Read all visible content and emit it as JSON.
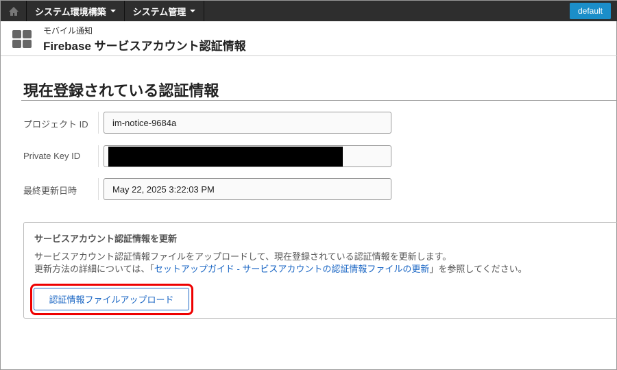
{
  "topbar": {
    "menus": [
      "システム環境構築",
      "システム管理"
    ],
    "user_button": "default"
  },
  "header": {
    "breadcrumb": "モバイル通知",
    "title": "Firebase サービスアカウント認証情報"
  },
  "section": {
    "title": "現在登録されている認証情報",
    "fields": [
      {
        "label": "プロジェクト ID",
        "value": "im-notice-9684a"
      },
      {
        "label": "Private Key ID",
        "value": ""
      },
      {
        "label": "最終更新日時",
        "value": "May 22, 2025 3:22:03 PM"
      }
    ]
  },
  "update": {
    "title": "サービスアカウント認証情報を更新",
    "line1": "サービスアカウント認証情報ファイルをアップロードして、現在登録されている認証情報を更新します。",
    "line2_pre": "更新方法の詳細については、「",
    "link": "セットアップガイド - サービスアカウントの認証情報ファイルの更新",
    "line2_post": "」を参照してください。",
    "button": "認証情報ファイルアップロード"
  }
}
